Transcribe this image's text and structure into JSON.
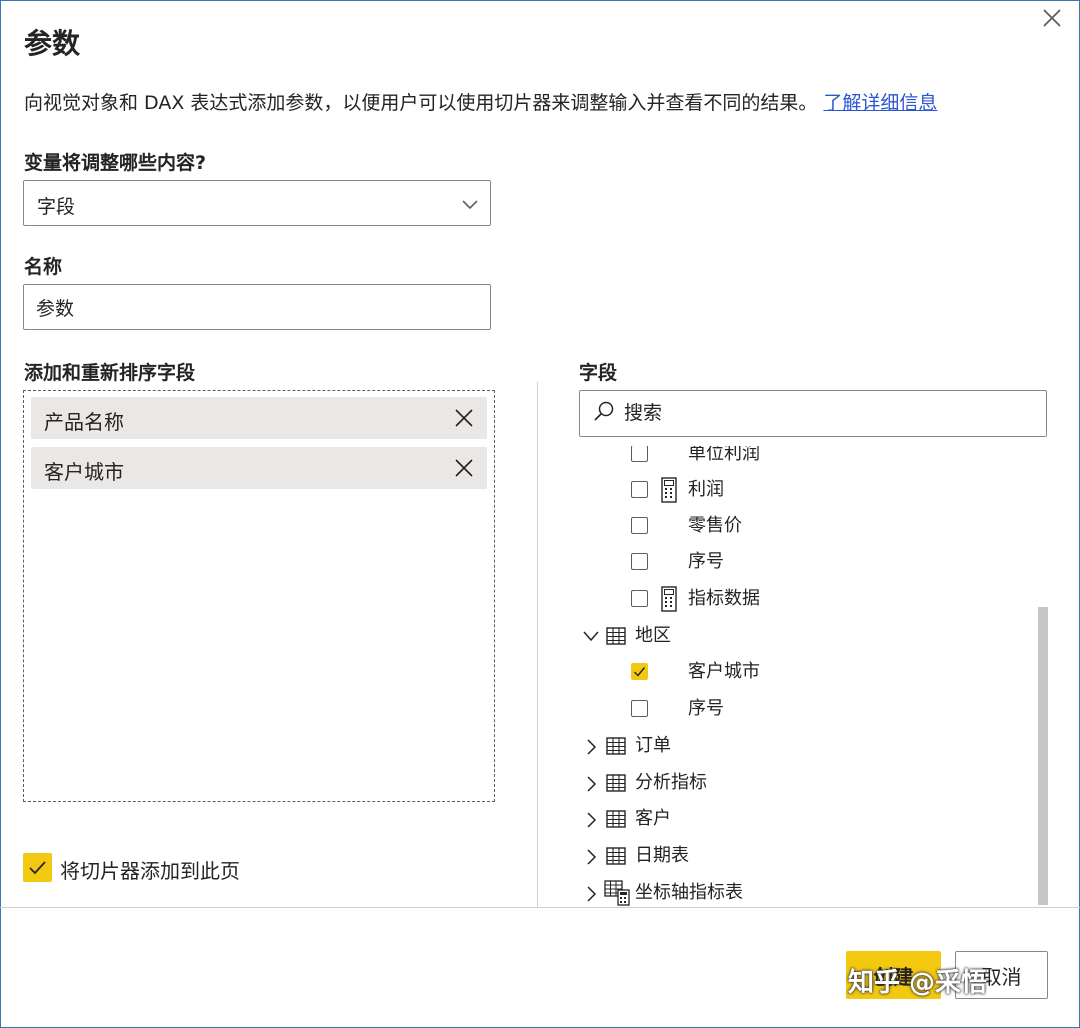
{
  "dialog": {
    "title": "参数",
    "description": "向视觉对象和 DAX 表达式添加参数，以便用户可以使用切片器来调整输入并查看不同的结果。",
    "learn_more": "了解详细信息"
  },
  "variable": {
    "label": "变量将调整哪些内容?",
    "selected": "字段"
  },
  "name": {
    "label": "名称",
    "value": "参数"
  },
  "add_fields": {
    "label": "添加和重新排序字段",
    "items": [
      "产品名称",
      "客户城市"
    ]
  },
  "fields_pane": {
    "label": "字段",
    "search_placeholder": "搜索",
    "tree": [
      {
        "label": "单位利润",
        "type": "field",
        "checked": false,
        "icon": ""
      },
      {
        "label": "利润",
        "type": "field",
        "checked": false,
        "icon": "calculator-icon"
      },
      {
        "label": "零售价",
        "type": "field",
        "checked": false,
        "icon": ""
      },
      {
        "label": "序号",
        "type": "field",
        "checked": false,
        "icon": ""
      },
      {
        "label": "指标数据",
        "type": "field",
        "checked": false,
        "icon": "calculator-icon"
      },
      {
        "label": "地区",
        "type": "table",
        "expanded": true,
        "icon": "table-icon"
      },
      {
        "label": "客户城市",
        "type": "field",
        "checked": true,
        "icon": ""
      },
      {
        "label": "序号",
        "type": "field",
        "checked": false,
        "icon": ""
      },
      {
        "label": "订单",
        "type": "table",
        "expanded": false,
        "icon": "table-icon"
      },
      {
        "label": "分析指标",
        "type": "table",
        "expanded": false,
        "icon": "table-icon"
      },
      {
        "label": "客户",
        "type": "table",
        "expanded": false,
        "icon": "table-icon"
      },
      {
        "label": "日期表",
        "type": "table",
        "expanded": false,
        "icon": "table-icon"
      },
      {
        "label": "坐标轴指标表",
        "type": "table",
        "expanded": false,
        "icon": "table-calc-icon"
      }
    ]
  },
  "slicer_option": {
    "label": "将切片器添加到此页",
    "checked": true
  },
  "buttons": {
    "ok": "创建",
    "cancel": "取消"
  },
  "watermark": "知乎 @采悟",
  "colors": {
    "accent": "#f2c811",
    "link": "#2b56d3",
    "border": "#8a8886"
  }
}
